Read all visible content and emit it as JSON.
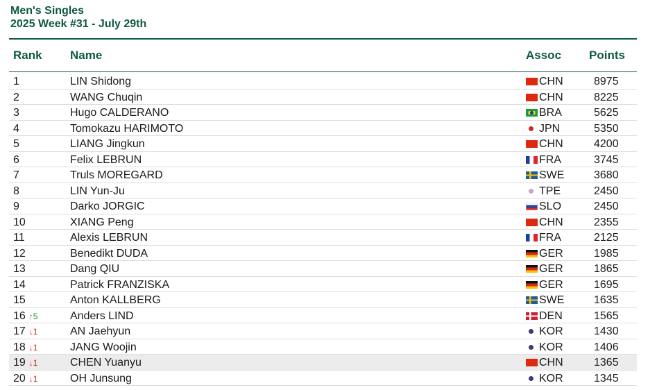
{
  "header": {
    "title": "Men's Singles",
    "subtitle": "2025 Week #31 - July 29th"
  },
  "columns": {
    "rank": "Rank",
    "name": "Name",
    "assoc": "Assoc",
    "points": "Points"
  },
  "colors": {
    "brand_green": "#0e5a3f",
    "up": "#1f8f3a",
    "down": "#d02626",
    "highlight_row": "#ececec"
  },
  "rows": [
    {
      "rank": "1",
      "change": "",
      "name": "LIN Shidong",
      "assoc": "CHN",
      "points": "8975",
      "flag": "china-flag-icon"
    },
    {
      "rank": "2",
      "change": "",
      "name": "WANG Chuqin",
      "assoc": "CHN",
      "points": "8225",
      "flag": "china-flag-icon"
    },
    {
      "rank": "3",
      "change": "",
      "name": "Hugo CALDERANO",
      "assoc": "BRA",
      "points": "5625",
      "flag": "brazil-flag-icon"
    },
    {
      "rank": "4",
      "change": "",
      "name": "Tomokazu HARIMOTO",
      "assoc": "JPN",
      "points": "5350",
      "flag": "japan-flag-icon"
    },
    {
      "rank": "5",
      "change": "",
      "name": "LIANG Jingkun",
      "assoc": "CHN",
      "points": "4200",
      "flag": "china-flag-icon"
    },
    {
      "rank": "6",
      "change": "",
      "name": "Felix LEBRUN",
      "assoc": "FRA",
      "points": "3745",
      "flag": "france-flag-icon"
    },
    {
      "rank": "7",
      "change": "",
      "name": "Truls MOREGARD",
      "assoc": "SWE",
      "points": "3680",
      "flag": "sweden-flag-icon"
    },
    {
      "rank": "8",
      "change": "",
      "name": "LIN Yun-Ju",
      "assoc": "TPE",
      "points": "2450",
      "flag": "chinese-taipei-flag-icon"
    },
    {
      "rank": "9",
      "change": "",
      "name": "Darko JORGIC",
      "assoc": "SLO",
      "points": "2450",
      "flag": "slovenia-flag-icon"
    },
    {
      "rank": "10",
      "change": "",
      "name": "XIANG Peng",
      "assoc": "CHN",
      "points": "2355",
      "flag": "china-flag-icon"
    },
    {
      "rank": "11",
      "change": "",
      "name": "Alexis LEBRUN",
      "assoc": "FRA",
      "points": "2125",
      "flag": "france-flag-icon"
    },
    {
      "rank": "12",
      "change": "",
      "name": "Benedikt DUDA",
      "assoc": "GER",
      "points": "1985",
      "flag": "germany-flag-icon"
    },
    {
      "rank": "13",
      "change": "",
      "name": "Dang QIU",
      "assoc": "GER",
      "points": "1865",
      "flag": "germany-flag-icon"
    },
    {
      "rank": "14",
      "change": "",
      "name": "Patrick FRANZISKA",
      "assoc": "GER",
      "points": "1695",
      "flag": "germany-flag-icon"
    },
    {
      "rank": "15",
      "change": "",
      "name": "Anton KALLBERG",
      "assoc": "SWE",
      "points": "1635",
      "flag": "sweden-flag-icon"
    },
    {
      "rank": "16",
      "change": "↑5",
      "change_dir": "up",
      "name": "Anders LIND",
      "assoc": "DEN",
      "points": "1565",
      "flag": "denmark-flag-icon"
    },
    {
      "rank": "17",
      "change": "↓1",
      "change_dir": "down",
      "name": "AN Jaehyun",
      "assoc": "KOR",
      "points": "1430",
      "flag": "korea-flag-icon"
    },
    {
      "rank": "18",
      "change": "↓1",
      "change_dir": "down",
      "name": "JANG Woojin",
      "assoc": "KOR",
      "points": "1406",
      "flag": "korea-flag-icon"
    },
    {
      "rank": "19",
      "change": "↓1",
      "change_dir": "down",
      "name": "CHEN Yuanyu",
      "assoc": "CHN",
      "points": "1365",
      "flag": "china-flag-icon",
      "highlighted": true
    },
    {
      "rank": "20",
      "change": "↓1",
      "change_dir": "down",
      "name": "OH Junsung",
      "assoc": "KOR",
      "points": "1345",
      "flag": "korea-flag-icon"
    }
  ]
}
